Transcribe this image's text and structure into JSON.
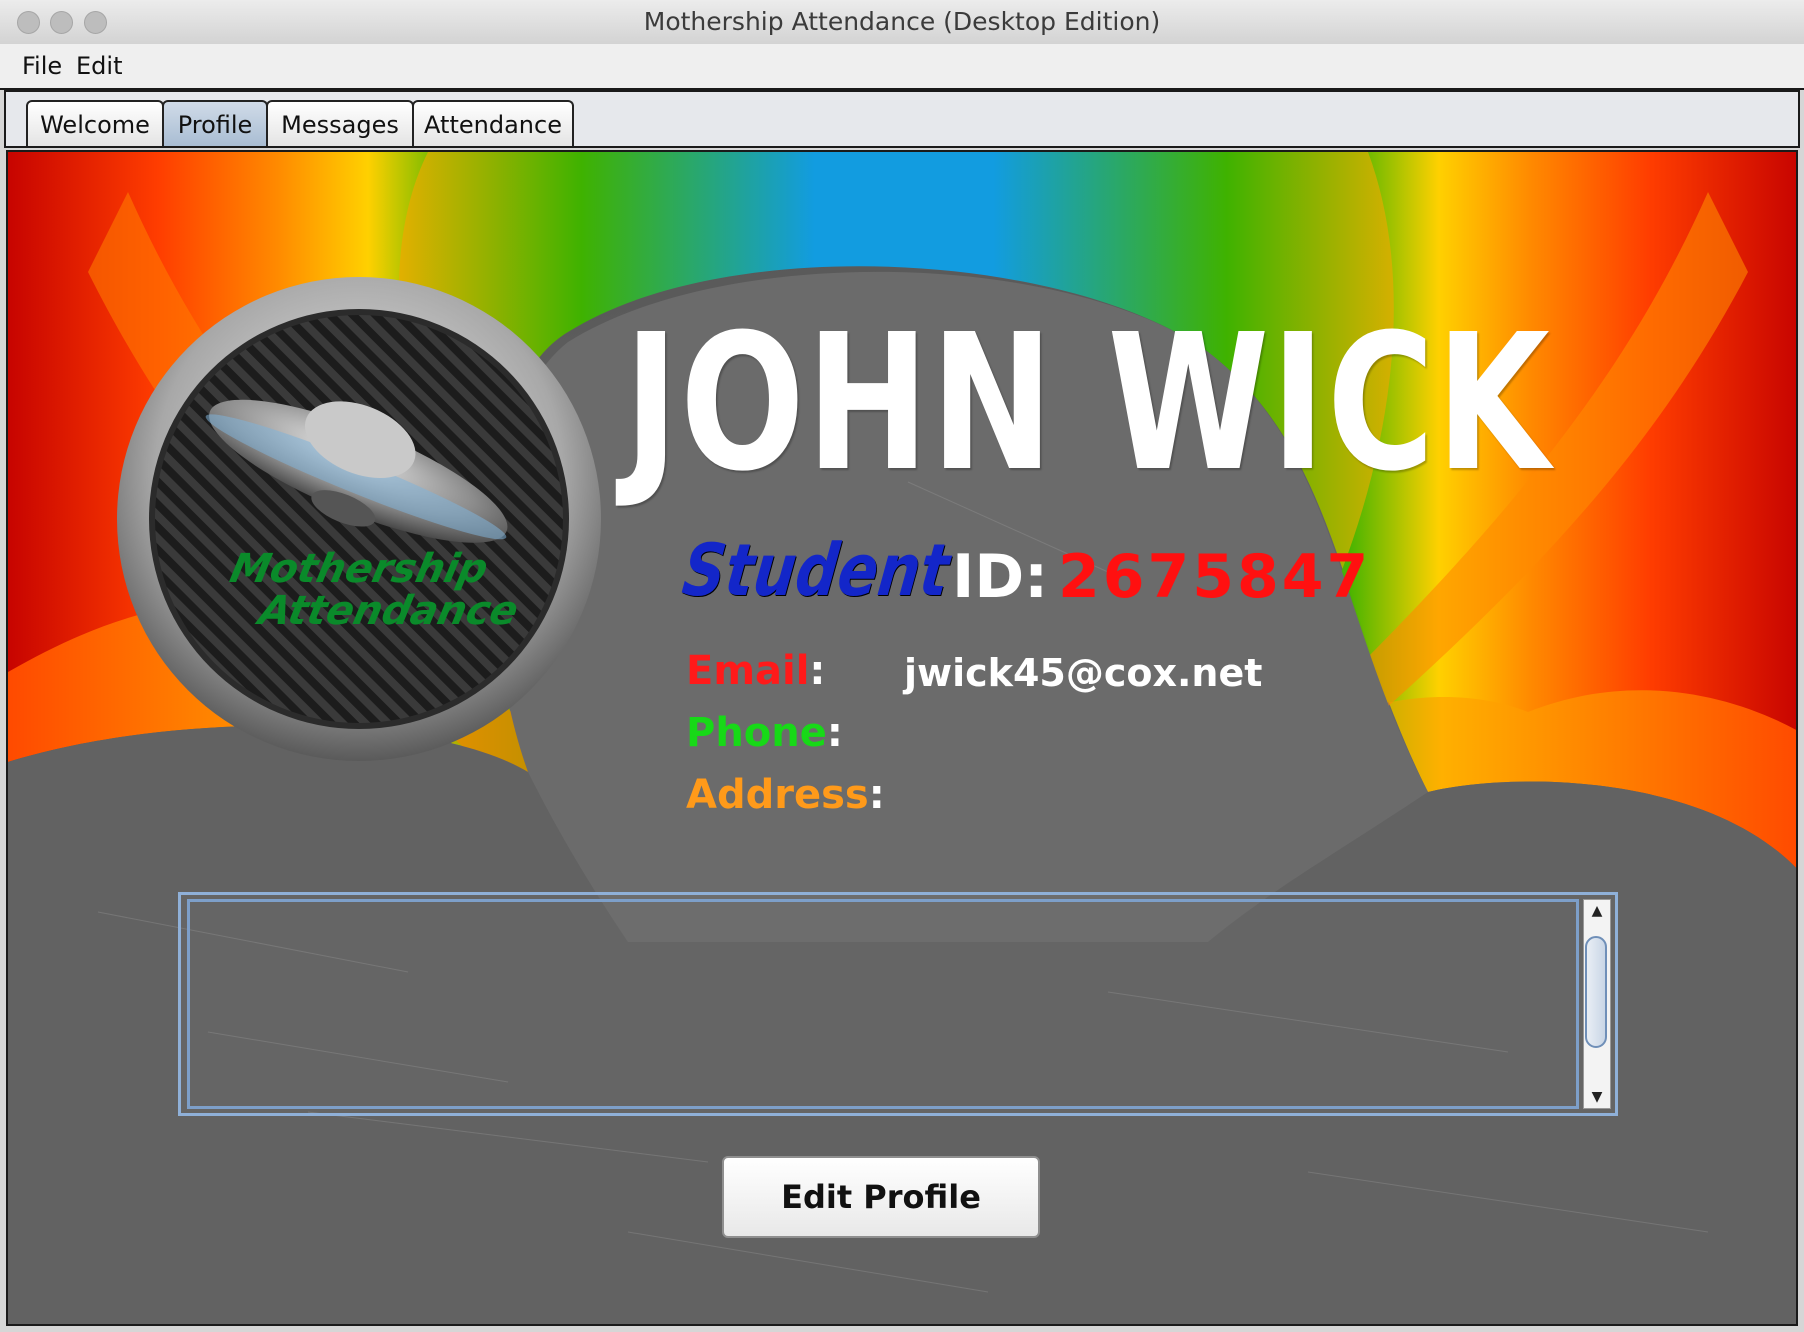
{
  "window": {
    "title": "Mothership Attendance (Desktop Edition)"
  },
  "menu": {
    "items": [
      "File",
      "Edit"
    ]
  },
  "tabs": [
    {
      "label": "Welcome",
      "active": false
    },
    {
      "label": "Profile",
      "active": true
    },
    {
      "label": "Messages",
      "active": false
    },
    {
      "label": "Attendance",
      "active": false
    }
  ],
  "logo": {
    "text_line1": "Mothership",
    "text_line2": "Attendance"
  },
  "profile": {
    "name": "JOHN WICK",
    "role": "Student",
    "id_label": "ID:",
    "id_value": "2675847",
    "email_label": "Email",
    "email_value": "jwick45@cox.net",
    "phone_label": "Phone",
    "address_label": "Address",
    "colon": ":"
  },
  "notes": {
    "value": ""
  },
  "actions": {
    "edit_profile_label": "Edit Profile"
  },
  "colors": {
    "id_value": "#ff1010",
    "email_label": "#ff1a1a",
    "phone_label": "#17d917",
    "address_label": "#ff9a1a",
    "role": "#1326c9"
  }
}
